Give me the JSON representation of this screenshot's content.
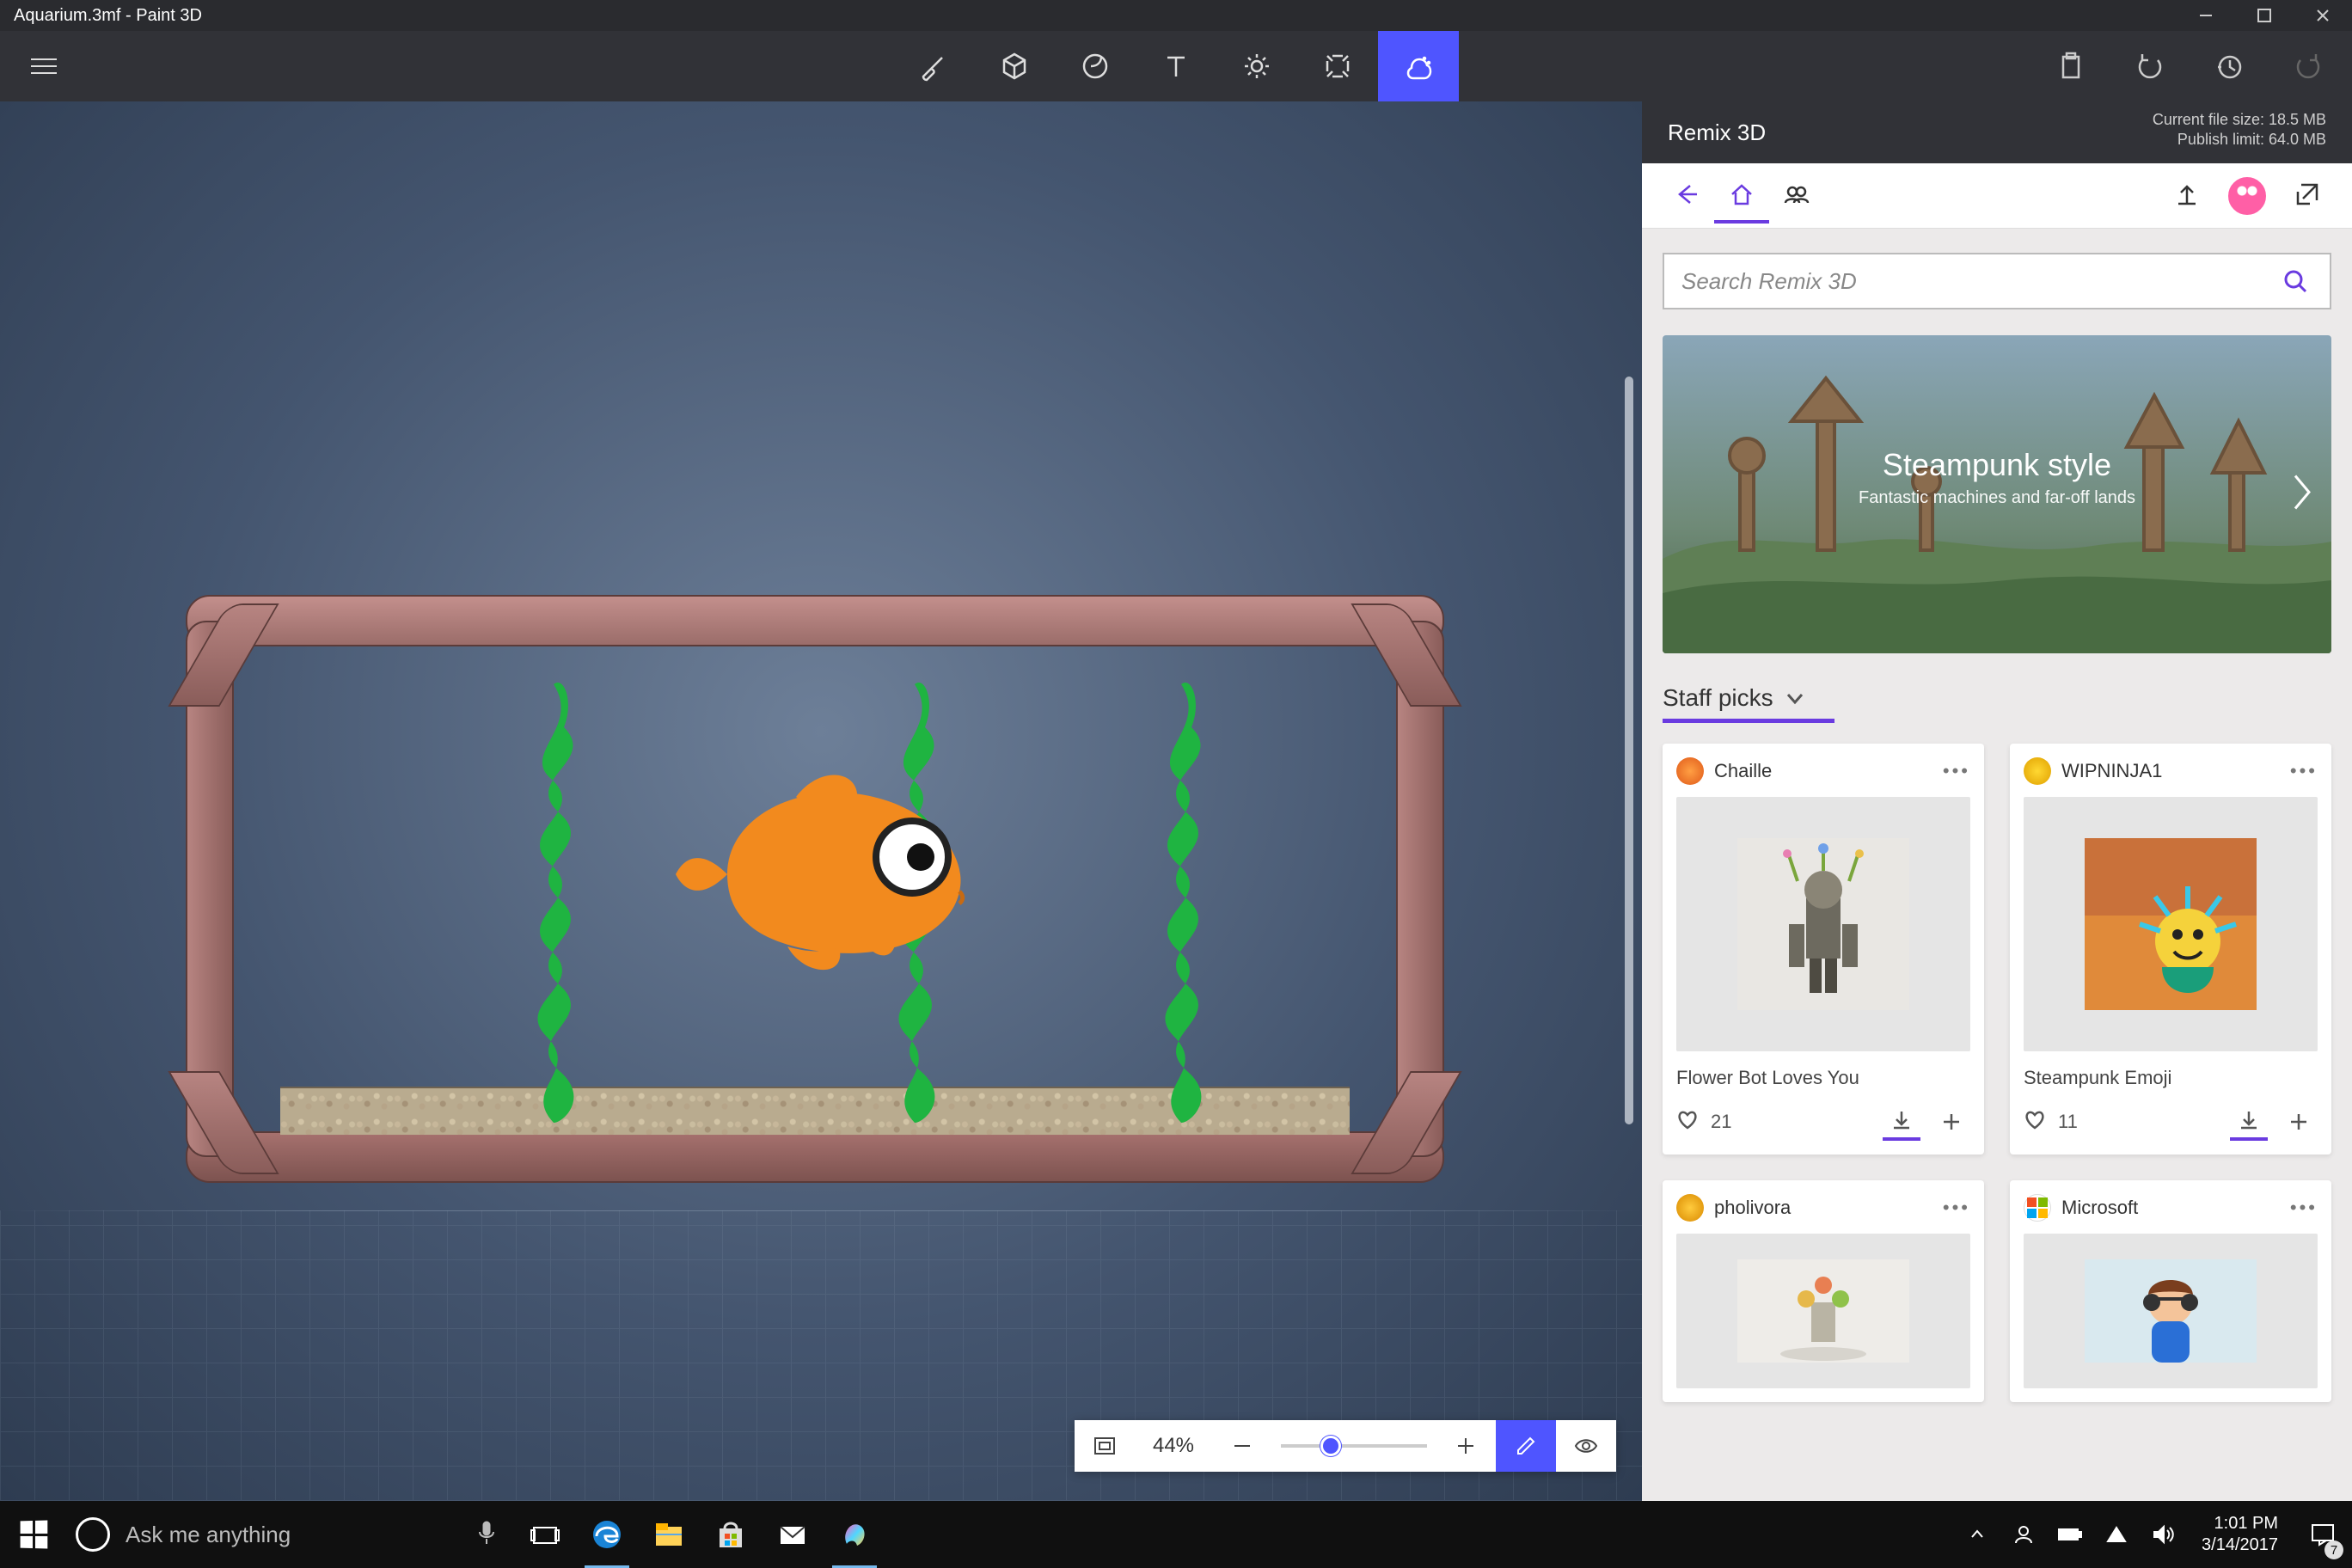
{
  "window": {
    "title": "Aquarium.3mf - Paint 3D"
  },
  "ribbon": {
    "tools": [
      "brush",
      "3d-objects",
      "stickers",
      "text",
      "effects",
      "canvas",
      "remix3d"
    ],
    "active": "remix3d"
  },
  "zoom": {
    "value": "44%"
  },
  "panel": {
    "title": "Remix 3D",
    "file_size_line": "Current file size: 18.5 MB",
    "publish_limit_line": "Publish limit: 64.0 MB",
    "search_placeholder": "Search Remix 3D",
    "hero": {
      "title": "Steampunk style",
      "subtitle": "Fantastic machines and far-off lands"
    },
    "section": "Staff picks",
    "cards": [
      {
        "user": "Chaille",
        "title": "Flower Bot Loves You",
        "likes": "21"
      },
      {
        "user": "WIPNINJA1",
        "title": "Steampunk Emoji",
        "likes": "11"
      },
      {
        "user": "pholivora",
        "title": "",
        "likes": ""
      },
      {
        "user": "Microsoft",
        "title": "",
        "likes": ""
      }
    ]
  },
  "taskbar": {
    "cortana": "Ask me anything",
    "time": "1:01 PM",
    "date": "3/14/2017",
    "notif_count": "7"
  }
}
